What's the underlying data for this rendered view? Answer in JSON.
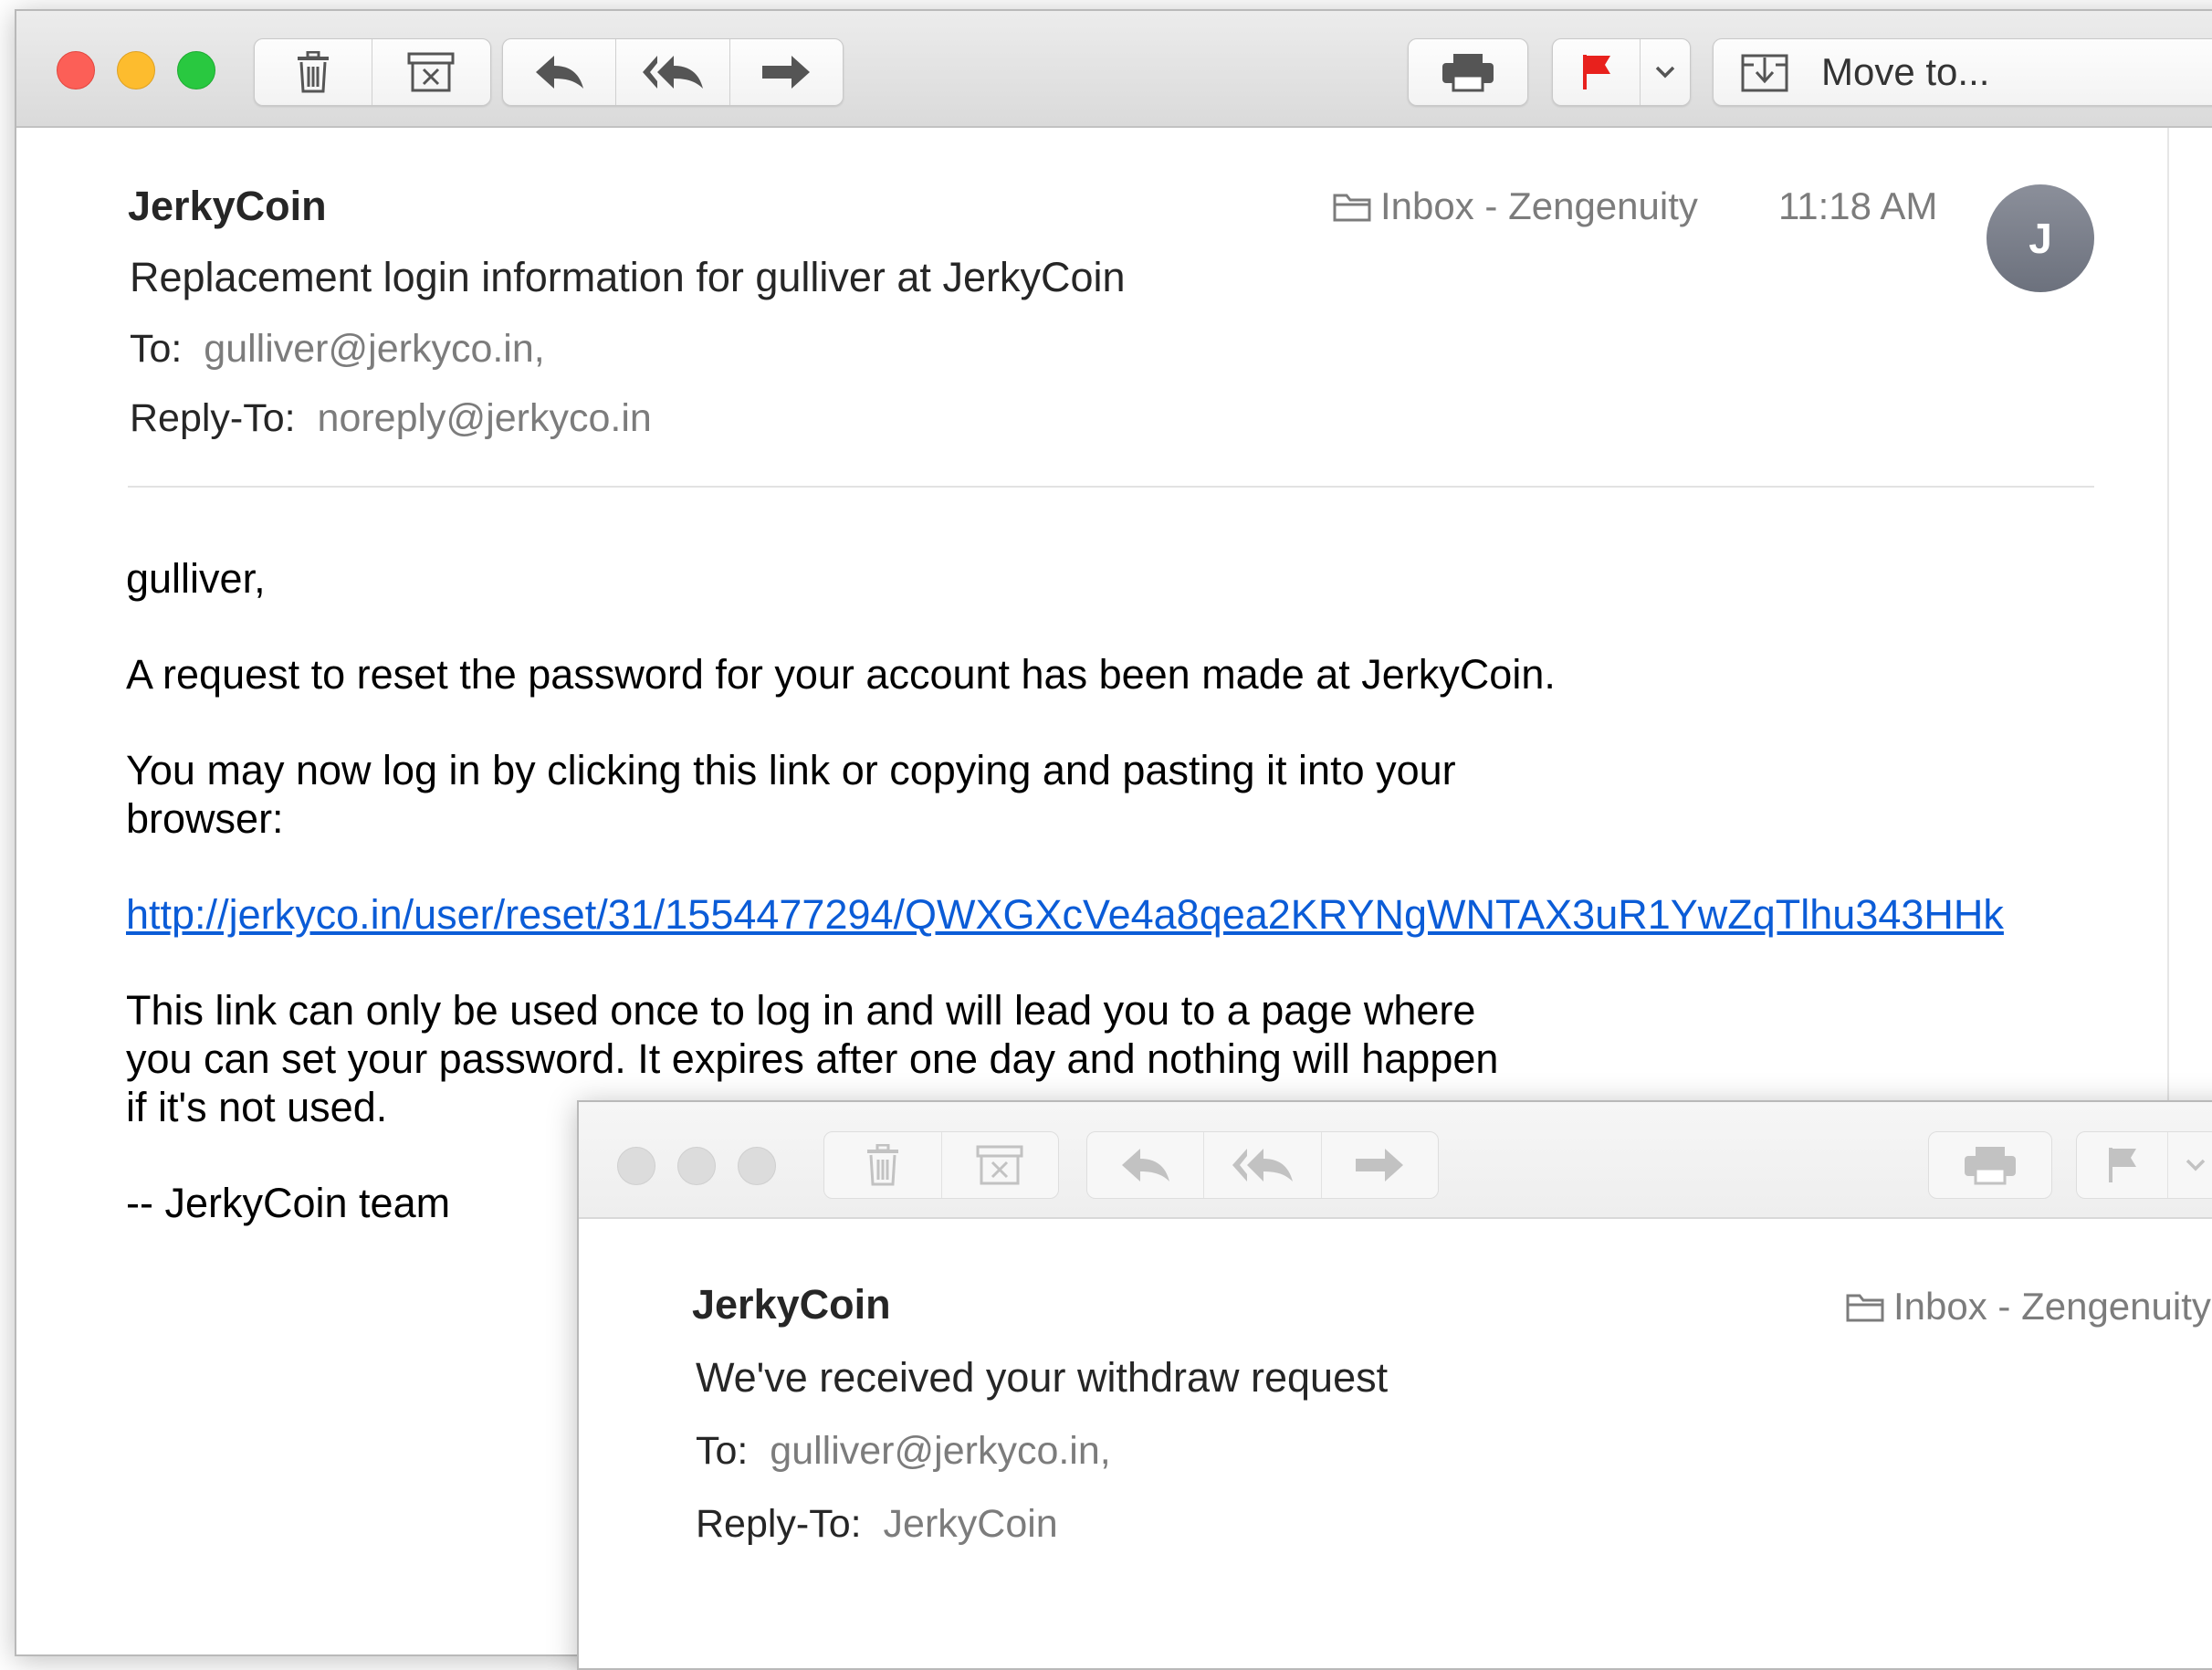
{
  "window1": {
    "toolbar": {
      "delete_icon": "trash-icon",
      "archive_icon": "archive-icon",
      "reply_icon": "reply-icon",
      "reply_all_icon": "reply-all-icon",
      "forward_icon": "forward-icon",
      "print_icon": "printer-icon",
      "flag_icon": "flag-icon",
      "flag_color": "#e8211d",
      "move_label": "Move to..."
    },
    "message": {
      "sender": "JerkyCoin",
      "subject": "Replacement login information for gulliver at JerkyCoin",
      "to_label": "To:",
      "to_value": "gulliver@jerkyco.in,",
      "reply_to_label": "Reply-To:",
      "reply_to_value": "noreply@jerkyco.in",
      "mailbox": "Inbox - Zengenuity",
      "time": "11:18 AM",
      "avatar_initial": "J"
    },
    "body": {
      "greeting": "gulliver,",
      "para1": "A request to reset the password for your account has been made at JerkyCoin.",
      "para2_line1": "You may now log in by clicking this link or copying and pasting it into your",
      "para2_line2": "browser:",
      "link": "http://jerkyco.in/user/reset/31/1554477294/QWXGXcVe4a8qea2KRYNgWNTAX3uR1YwZqTlhu343HHk",
      "para3_line1": "This link can only be used once to log in and will lead you to a page where",
      "para3_line2": "you can set your password. It expires after one day and nothing will happen",
      "para3_line3": "if it's not used.",
      "signature": "--  JerkyCoin team"
    }
  },
  "window2": {
    "message": {
      "sender": "JerkyCoin",
      "subject": "We've received your withdraw request",
      "to_label": "To:",
      "to_value": "gulliver@jerkyco.in,",
      "reply_to_label": "Reply-To:",
      "reply_to_value": "JerkyCoin",
      "mailbox": "Inbox - Zengenuity"
    }
  },
  "colors": {
    "close": "#fc5f57",
    "minimize": "#fdbc2e",
    "zoom": "#29c840",
    "inactive_light": "#dcdcdc",
    "link": "#0b5cd7"
  }
}
